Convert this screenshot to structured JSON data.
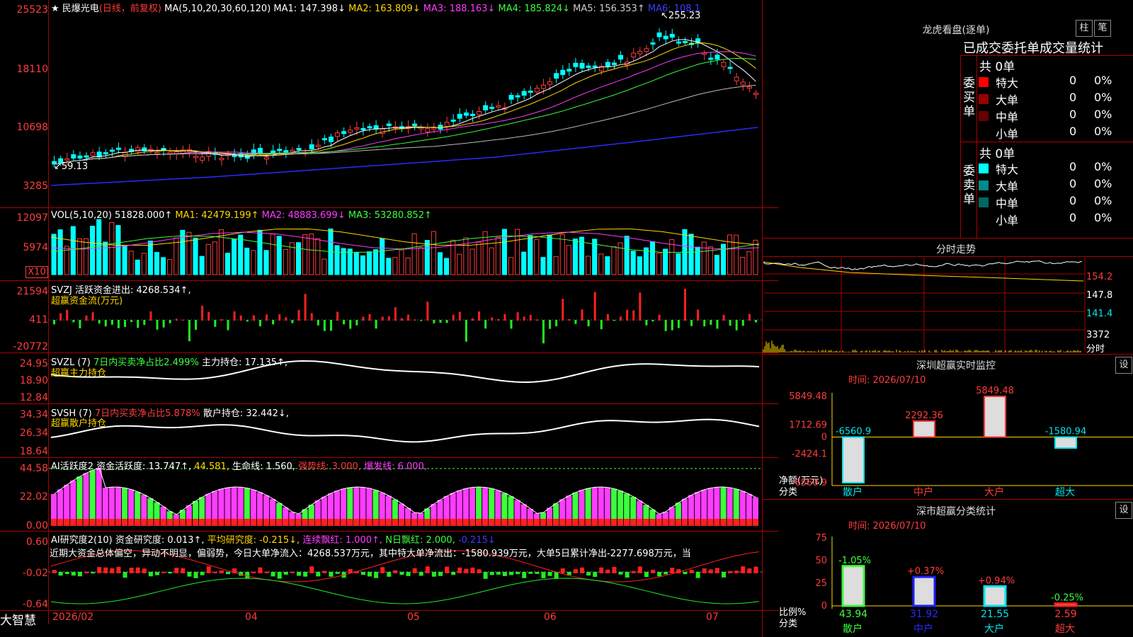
{
  "stock": {
    "name": "民爆光电",
    "period": "(日线，前复权)",
    "ma_label": "MA(5,10,20,30,60,120)",
    "ma1": "MA1: 147.398↓",
    "ma2": "MA2: 163.809↓",
    "ma3": "MA3: 188.163↓",
    "ma4": "MA4: 185.824↓",
    "ma5": "MA5: 156.353↑",
    "ma6": "MA6: 108.1",
    "high_mark": "255.23",
    "low_mark": "59.13",
    "stars": "★"
  },
  "price_axis": [
    "25523",
    "18110",
    "10698",
    "3285"
  ],
  "volume": {
    "header": "VOL(5,10,20)",
    "value": "51828.000↑",
    "ma1": "MA1: 42479.199↑",
    "ma2": "MA2: 48883.699↓",
    "ma3": "MA3: 53280.852↑",
    "axis": [
      "12097",
      "5974"
    ],
    "unit": "X10"
  },
  "svzj": {
    "header": "SVZJ  活跃资金进出: 4268.534↑,",
    "subtitle": "超赢资金流(万元)",
    "axis": [
      "21594",
      "411",
      "-20772"
    ]
  },
  "svzl": {
    "header_a": "SVZL (7)",
    "header_b": "7日内买卖净占比2.499%",
    "header_c": "主力持仓: 17.135↑,",
    "subtitle": "超赢主力持仓",
    "axis": [
      "24.95",
      "18.90",
      "12.84"
    ]
  },
  "svsh": {
    "header_a": "SVSH (7)",
    "header_b": "7日内买卖净占比5.878%",
    "header_c": "散户持仓: 32.442↓,",
    "subtitle": "超赢散户持仓",
    "axis": [
      "34.34",
      "26.34",
      "18.64"
    ]
  },
  "ai_active": {
    "header_a": "AI活跃度2 资金活跃度: 13.747↑,",
    "header_b": "44.581,",
    "header_c": "生命线: 1.560,",
    "header_d": "强势线: 3.000,",
    "header_e": "爆发线: 6.000,",
    "axis": [
      "44.58",
      "22.02",
      "0.00"
    ]
  },
  "ai_research": {
    "header_a": "AI研究度2(10) 资金研究度: 0.013↑,",
    "header_b": "平均研究度: -0.215↓,",
    "header_c": "连续飘红: 1.000↑,",
    "header_d": "N日飘红: 2.000,",
    "header_e": "-0.215↓",
    "comment": "近期大资金总体偏空，异动不明显，偏弱势，今日大单净流入：4268.537万元，其中特大单净流出：-1580.939万元，大单5日累计净出-2277.698万元，当",
    "axis": [
      "0.60",
      "-0.02",
      "-0.64"
    ]
  },
  "date_axis": [
    "2026/02",
    "04",
    "05",
    "06",
    "07"
  ],
  "brand": "大智慧",
  "dragon_tiger": {
    "title": "龙虎看盘(逐单)",
    "btn_bar": "柱",
    "btn_pen": "笔",
    "subtitle": "已成交委托单成交量统计",
    "buy_label": "委买单",
    "sell_label": "委卖单",
    "buy_total": "共 0单",
    "sell_total": "共 0单",
    "buy_rows": [
      {
        "label": "特大",
        "count": "0",
        "pct": "0%",
        "color": "#ff0000"
      },
      {
        "label": "大单",
        "count": "0",
        "pct": "0%",
        "color": "#990000"
      },
      {
        "label": "中单",
        "count": "0",
        "pct": "0%",
        "color": "#660000"
      },
      {
        "label": "小单",
        "count": "0",
        "pct": "0%",
        "color": "#000000"
      }
    ],
    "sell_rows": [
      {
        "label": "特大",
        "count": "0",
        "pct": "0%",
        "color": "#00ffff"
      },
      {
        "label": "大单",
        "count": "0",
        "pct": "0%",
        "color": "#008b8b"
      },
      {
        "label": "中单",
        "count": "0",
        "pct": "0%",
        "color": "#006666"
      },
      {
        "label": "小单",
        "count": "0",
        "pct": "0%",
        "color": "#000000"
      }
    ]
  },
  "intraday": {
    "title": "分时走势",
    "axis": [
      "154.2",
      "147.8",
      "141.4"
    ],
    "vol_axis": "3372",
    "vol_label": "分时"
  },
  "sz_monitor": {
    "title": "深圳超赢实时监控",
    "btn": "设",
    "time": "时间: 2026/07/10",
    "axis": [
      "5849.48",
      "1712.69",
      "0",
      "-2424.1",
      "-6560.9"
    ],
    "ylabel_a": "净额(万元)",
    "ylabel_b": "分类",
    "chart_data": {
      "type": "bar",
      "categories": [
        "散户",
        "中户",
        "大户",
        "超大"
      ],
      "values": [
        -6560.9,
        2292.36,
        5849.48,
        -1580.94
      ],
      "ylim": [
        -6560.9,
        5849.48
      ]
    }
  },
  "sz_stats": {
    "title": "深市超赢分类统计",
    "btn": "设",
    "time": "时间: 2026/07/10",
    "axis": [
      "75",
      "50",
      "25",
      "0"
    ],
    "ylabel_a": "比例%",
    "ylabel_b": "分类",
    "chart_data": {
      "type": "bar",
      "categories": [
        "散户",
        "中户",
        "大户",
        "超大"
      ],
      "values": [
        43.94,
        31.92,
        21.55,
        2.59
      ],
      "changes": [
        "-1.05%",
        "+0.37%",
        "+0.94%",
        "-0.25%"
      ],
      "ylim": [
        0,
        75
      ]
    }
  }
}
